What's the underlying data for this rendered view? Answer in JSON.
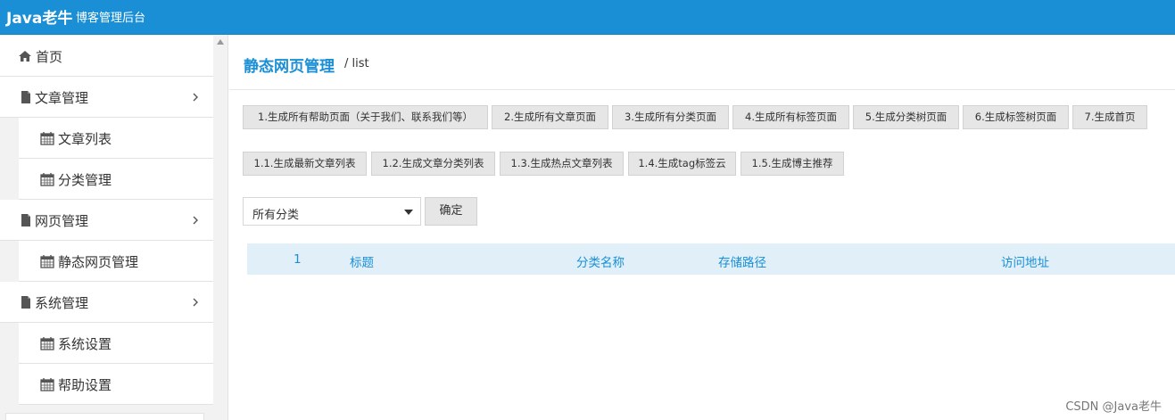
{
  "header": {
    "brand": "Java老牛",
    "subtitle": "博客管理后台",
    "bg_color": "#1a8fd6"
  },
  "sidebar": {
    "items": [
      {
        "label": "首页",
        "icon": "home-icon",
        "level": 0
      },
      {
        "label": "文章管理",
        "icon": "file-icon",
        "level": 0,
        "expandable": true
      },
      {
        "label": "文章列表",
        "icon": "calendar-icon",
        "level": 1
      },
      {
        "label": "分类管理",
        "icon": "calendar-icon",
        "level": 1
      },
      {
        "label": "网页管理",
        "icon": "file-icon",
        "level": 0,
        "expandable": true
      },
      {
        "label": "静态网页管理",
        "icon": "calendar-icon",
        "level": 1
      },
      {
        "label": "系统管理",
        "icon": "file-icon",
        "level": 0,
        "expandable": true
      },
      {
        "label": "系统设置",
        "icon": "calendar-icon",
        "level": 1
      },
      {
        "label": "帮助设置",
        "icon": "calendar-icon",
        "level": 1
      }
    ]
  },
  "main": {
    "title": "静态网页管理",
    "breadcrumb": "/ list",
    "buttons_row1": [
      "1.生成所有帮助页面（关于我们、联系我们等）",
      "2.生成所有文章页面",
      "3.生成所有分类页面",
      "4.生成所有标签页面",
      "5.生成分类树页面",
      "6.生成标签树页面",
      "7.生成首页"
    ],
    "buttons_row2": [
      "1.1.生成最新文章列表",
      "1.2.生成文章分类列表",
      "1.3.生成热点文章列表",
      "1.4.生成tag标签云",
      "1.5.生成博主推荐"
    ],
    "filter": {
      "selected": "所有分类",
      "confirm_label": "确定"
    },
    "table": {
      "headers": [
        "1",
        "标题",
        "分类名称",
        "存储路径",
        "访问地址"
      ]
    }
  },
  "watermark": "CSDN @Java老牛"
}
